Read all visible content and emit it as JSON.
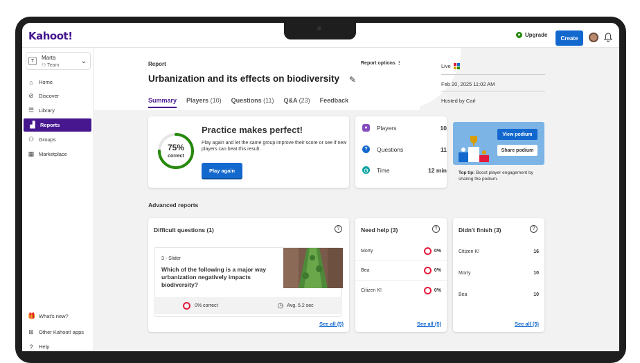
{
  "app": {
    "logo": "Kahoot!",
    "upgrade_label": "Upgrade",
    "create_label": "Create"
  },
  "user": {
    "initial": "T",
    "name": "Marta",
    "team": "Team"
  },
  "sidebar": {
    "items": [
      {
        "label": "Home",
        "icon": "home-icon"
      },
      {
        "label": "Discover",
        "icon": "compass-icon"
      },
      {
        "label": "Library",
        "icon": "list-icon"
      },
      {
        "label": "Reports",
        "icon": "bar-chart-icon",
        "active": true
      },
      {
        "label": "Groups",
        "icon": "groups-icon"
      },
      {
        "label": "Marketplace",
        "icon": "store-icon"
      }
    ],
    "bottom": [
      {
        "label": "What's new?",
        "icon": "gift-icon"
      },
      {
        "label": "Other Kahoot! apps",
        "icon": "apps-icon"
      },
      {
        "label": "Help",
        "icon": "help-icon"
      }
    ]
  },
  "header": {
    "label": "Report",
    "options_label": "Report options",
    "title": "Urbanization and its effects on biodiversity",
    "tabs": [
      {
        "label": "Summary",
        "count": ""
      },
      {
        "label": "Players",
        "count": "(10)"
      },
      {
        "label": "Questions",
        "count": "(11)"
      },
      {
        "label": "Q&A",
        "count": "(23)"
      },
      {
        "label": "Feedback",
        "count": ""
      }
    ],
    "live": "Live",
    "date": "Feb 20, 2025 11:02 AM",
    "host": "Hosted by Carl"
  },
  "summary": {
    "percent": "75%",
    "percent_label": "correct",
    "percent_value": 0.75,
    "title": "Practice makes perfect!",
    "text": "Play again and let the same group improve their score or see if new players can beat this result.",
    "play_again": "Play again"
  },
  "stats": [
    {
      "label": "Players",
      "value": "10",
      "icon": "player-icon",
      "color": "#864cbf"
    },
    {
      "label": "Questions",
      "value": "11",
      "icon": "question-icon",
      "color": "#1368ce"
    },
    {
      "label": "Time",
      "value": "12 min",
      "icon": "clock-icon",
      "color": "#0aa3a3"
    }
  ],
  "podium": {
    "view": "View podium",
    "share": "Share podium",
    "tip_bold": "Top tip:",
    "tip": "Boost player engagement by sharing the podium."
  },
  "advanced": {
    "title": "Advanced reports",
    "difficult": {
      "title": "Difficult questions (1)",
      "type": "3 - Slider",
      "question": "Which of the following is a major way urbanization negatively impacts biodiversity?",
      "correct": "0% correct",
      "avg": "Avg. 5.2 sec",
      "see_all": "See all (5)"
    },
    "need_help": {
      "title": "Need help (3)",
      "rows": [
        {
          "name": "Morty",
          "value": "0%"
        },
        {
          "name": "Bea",
          "value": "0%"
        },
        {
          "name": "Citizen K!",
          "value": "0%"
        }
      ],
      "see_all": "See all (5)"
    },
    "didnt_finish": {
      "title": "Didn't finish (3)",
      "rows": [
        {
          "name": "Citizen K!",
          "value": "16"
        },
        {
          "name": "Morty",
          "value": "10"
        },
        {
          "name": "Bea",
          "value": "10"
        }
      ],
      "see_all": "See all (5)"
    }
  },
  "colors": {
    "brand": "#46178f",
    "primary": "#1368ce",
    "green": "#26890c",
    "red": "#e21b3c"
  }
}
